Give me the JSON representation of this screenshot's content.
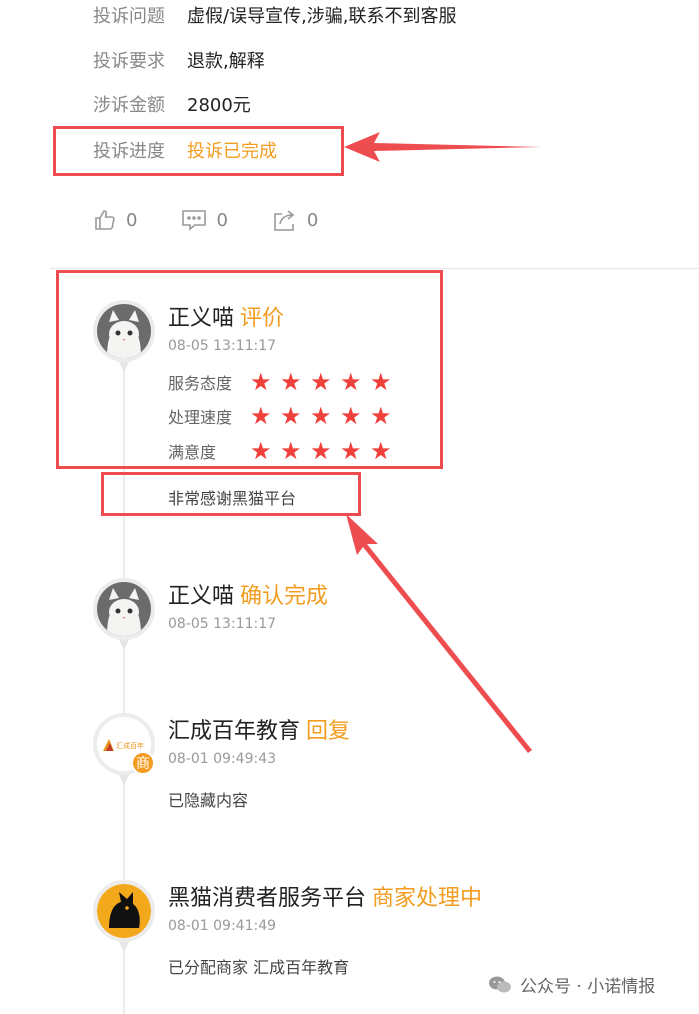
{
  "complaint": {
    "rows": [
      {
        "label": "投诉问题",
        "value": "虚假/误导宣传,涉骗,联系不到客服"
      },
      {
        "label": "投诉要求",
        "value": "退款,解释"
      },
      {
        "label": "涉诉金额",
        "value": "2800元"
      },
      {
        "label": "投诉进度",
        "value": "投诉已完成"
      }
    ]
  },
  "actions": {
    "like_count": "0",
    "comment_count": "0",
    "share_count": "0"
  },
  "timeline": [
    {
      "user": "正义喵",
      "action": "评价",
      "time": "08-05 13:11:17",
      "ratings": [
        {
          "label": "服务态度",
          "stars": 5
        },
        {
          "label": "处理速度",
          "stars": 5
        },
        {
          "label": "满意度",
          "stars": 5
        }
      ],
      "text": "非常感谢黑猫平台"
    },
    {
      "user": "正义喵",
      "action": "确认完成",
      "time": "08-05 13:11:17"
    },
    {
      "user": "汇成百年教育",
      "action": "回复",
      "time": "08-01 09:49:43",
      "text": "已隐藏内容",
      "badge": "商",
      "logo_text": "汇成百年"
    },
    {
      "user": "黑猫消费者服务平台",
      "action": "商家处理中",
      "time": "08-01 09:41:49",
      "text": "已分配商家 汇成百年教育"
    }
  ],
  "watermark": "公众号 · 小诺情报",
  "colors": {
    "accent_orange": "#f39c1f",
    "star_red": "#f0403c",
    "annotation_red": "#ee4d50"
  }
}
